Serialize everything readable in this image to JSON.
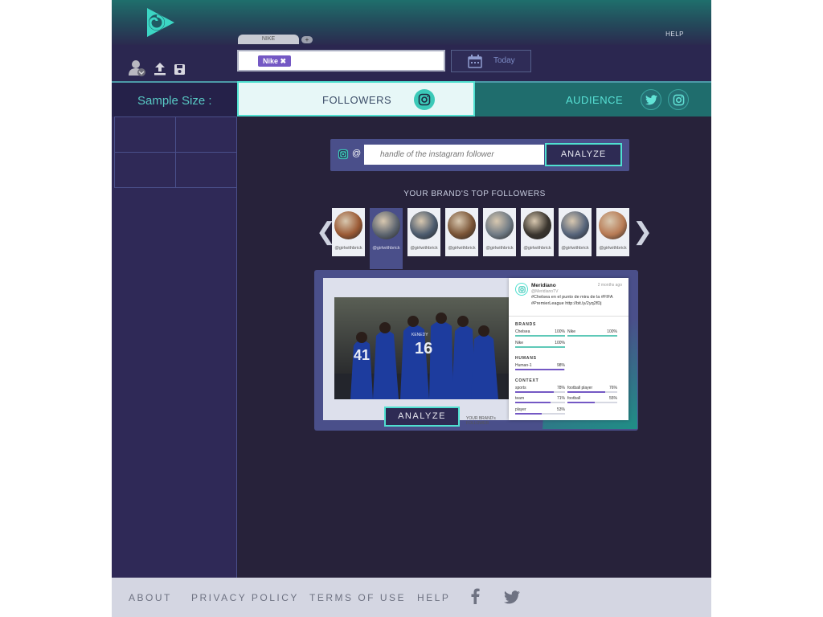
{
  "header": {
    "help": "HELP",
    "tab_label": "NIKE",
    "tab_add": "+",
    "search_tag": "Nike ✖",
    "date_label": "Today"
  },
  "toolbar": {
    "icons": [
      "user-menu-icon",
      "upload-icon",
      "save-icon"
    ]
  },
  "sample": {
    "label": "Sample Size :"
  },
  "tabs": {
    "followers": "FOLLOWERS",
    "audience": "AUDIENCE"
  },
  "handle_search": {
    "at": "@",
    "placeholder": "handle of the instagram follower",
    "button": "ANALYZE"
  },
  "top_followers": {
    "title": "YOUR BRAND'S  TOP FOLLOWERS",
    "items": [
      {
        "name": "@girlwithbrick",
        "color": "#9b5a35"
      },
      {
        "name": "@girlwithbrick",
        "color": "#5d6570"
      },
      {
        "name": "@girlwithbrick",
        "color": "#4c5b6e"
      },
      {
        "name": "@girlwithbrick",
        "color": "#7a5436"
      },
      {
        "name": "@girlwithbrick",
        "color": "#6f7a84"
      },
      {
        "name": "@girlwithbrick",
        "color": "#3a352e"
      },
      {
        "name": "@girlwithbrick",
        "color": "#56647a"
      },
      {
        "name": "@girlwithbrick",
        "color": "#b87b55"
      }
    ]
  },
  "post": {
    "analyze": "ANALYZE",
    "brand_follower": "YOUR BRAND's FOLLOWER",
    "user": "Meridiano",
    "handle": "@MeridianoTV",
    "time": "2 months ago",
    "text": "#Chelsea en el punto de mira de la #FIFA #PremierLeague http://bit.ly/2yq2fDj",
    "sections": {
      "brands": "BRANDS",
      "humans": "HUMANS",
      "context": "CONTEXT"
    },
    "brands": [
      {
        "name": "Chelsea",
        "value": "100%",
        "pct": 1.0
      },
      {
        "name": "Nike",
        "value": "100%",
        "pct": 1.0
      },
      {
        "name": "Nike",
        "value": "100%",
        "pct": 1.0
      }
    ],
    "humans": [
      {
        "name": "Human-1",
        "value": "98%",
        "pct": 0.98
      }
    ],
    "context": [
      {
        "name": "sports",
        "value": "78%",
        "pct": 0.78
      },
      {
        "name": "football player",
        "value": "76%",
        "pct": 0.76
      },
      {
        "name": "team",
        "value": "71%",
        "pct": 0.71
      },
      {
        "name": "football",
        "value": "55%",
        "pct": 0.55
      },
      {
        "name": "player",
        "value": "53%",
        "pct": 0.53
      }
    ],
    "colors": {
      "brand_bar": "#5fc9b8",
      "human_bar": "#7458c4",
      "context_bar": "#7458c4"
    }
  },
  "footer": {
    "about": "ABOUT",
    "privacy": "PRIVACY POLICY",
    "terms": "TERMS OF USE",
    "help": "HELP",
    "icons": [
      "facebook-icon",
      "twitter-icon"
    ]
  },
  "colors": {
    "accent_teal": "#4fe0d0",
    "panel_purple": "#4a4f8a",
    "tag_purple": "#7458c4"
  }
}
